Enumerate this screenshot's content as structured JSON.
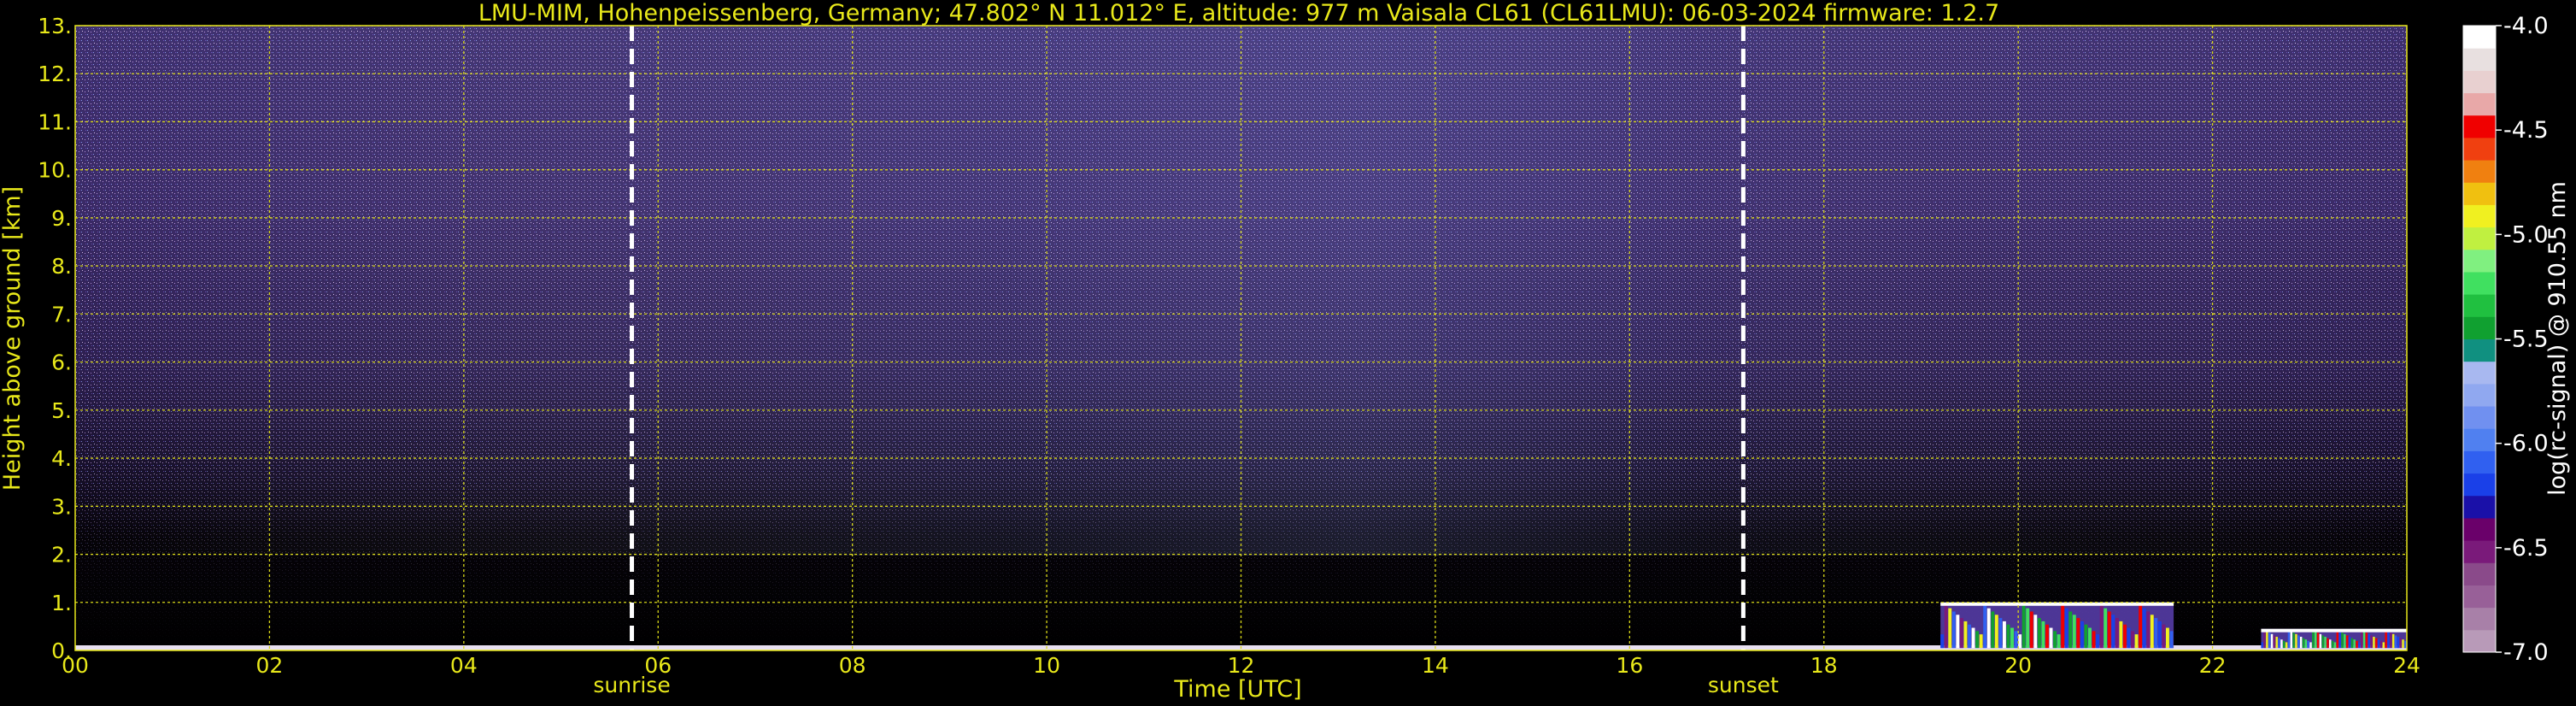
{
  "chart_data": {
    "type": "heatmap",
    "title": "LMU-MIM, Hohenpeissenberg, Germany; 47.802° N 11.012° E, altitude: 977 m    Vaisala CL61 (CL61LMU): 06-03-2024    firmware: 1.2.7",
    "xlabel": "Time [UTC]",
    "ylabel": "Height above ground [km]",
    "xlim": [
      0,
      24
    ],
    "ylim": [
      0,
      13
    ],
    "xticks": [
      "00",
      "02",
      "04",
      "06",
      "08",
      "10",
      "12",
      "14",
      "16",
      "18",
      "20",
      "22",
      "24"
    ],
    "yticks": [
      "0.",
      "1.",
      "2.",
      "3.",
      "4.",
      "5.",
      "6.",
      "7.",
      "8.",
      "9.",
      "10.",
      "11.",
      "12.",
      "13."
    ],
    "grid": true,
    "annotations": [
      {
        "label": "sunrise",
        "x": 5.73
      },
      {
        "label": "sunset",
        "x": 17.17
      }
    ],
    "cloud_layers": [
      {
        "x_start": 19.2,
        "x_end": 21.6,
        "base_km": 0.05,
        "top_km": 1.0
      },
      {
        "x_start": 22.5,
        "x_end": 24.0,
        "base_km": 0.05,
        "top_km": 0.45
      }
    ],
    "colorbar": {
      "label": "log(rc-signal) @ 910.55 nm",
      "range": [
        -7.0,
        -4.0
      ],
      "ticks": [
        "-4.0",
        "-4.5",
        "-5.0",
        "-5.5",
        "-6.0",
        "-6.5",
        "-7.0"
      ],
      "colors": [
        "#b89ab8",
        "#a880a8",
        "#986098",
        "#8a4a8a",
        "#7a1a7a",
        "#6a006a",
        "#1a10a8",
        "#1a40e8",
        "#3060f0",
        "#5080f0",
        "#7090f0",
        "#90a8f0",
        "#a8b8f0",
        "#109080",
        "#10a030",
        "#20c040",
        "#40e060",
        "#80f080",
        "#c0f040",
        "#f0f020",
        "#f0c010",
        "#f08010",
        "#f04010",
        "#f00000",
        "#e8a8a8",
        "#e8d0d0",
        "#e8e0e0",
        "#ffffff"
      ]
    }
  }
}
